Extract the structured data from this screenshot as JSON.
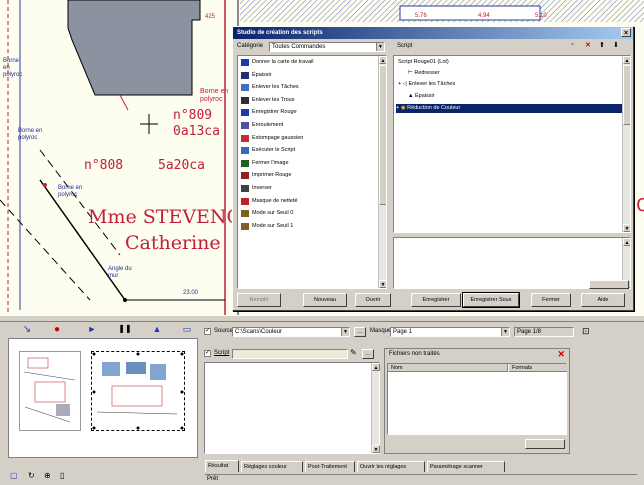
{
  "map": {
    "number_top_1": "425",
    "number_top_2": "5.76",
    "number_top_3": "4.94",
    "number_top_4": "5.10",
    "parcel_809_number": "n°809",
    "parcel_809_area": "0a13ca",
    "parcel_808_number": "n°808",
    "parcel_808_area": "5a20ca",
    "owner_line1": "Mme STEVENC",
    "owner_line2": "Catherine",
    "borne_label_1": "Borne en polyroc",
    "borne_label_2": "Borne en polyroc",
    "borne_label_3": "Borne en polyroc",
    "angle_label": "Angle du mur",
    "dim_label": "23.00",
    "edge_letter": "C"
  },
  "dialog": {
    "title": "Studio de création des scripts",
    "category_label": "Catégorie",
    "category_value": "Toutes Commandes",
    "script_label": "Script",
    "commands": [
      {
        "label": "Donner la carte de travail",
        "icon": "map-icon"
      },
      {
        "label": "Épaissir",
        "icon": "thicken-icon"
      },
      {
        "label": "Enlever les Tâches",
        "icon": "spots-icon"
      },
      {
        "label": "Enlever les Trous",
        "icon": "holes-icon"
      },
      {
        "label": "Enregistrer Rouge",
        "icon": "save-red-icon"
      },
      {
        "label": "Enroulement",
        "icon": "wrap-icon"
      },
      {
        "label": "Estompage gaussien",
        "icon": "gauss-icon"
      },
      {
        "label": "Exécuter le Script",
        "icon": "run-icon"
      },
      {
        "label": "Fermer l'image",
        "icon": "close-image-icon"
      },
      {
        "label": "Imprimer Rouge",
        "icon": "print-icon"
      },
      {
        "label": "Inverser",
        "icon": "invert-icon"
      },
      {
        "label": "Masque de netteté",
        "icon": "sharpen-icon"
      },
      {
        "label": "Mode sur Seuil 0",
        "icon": "threshold-icon"
      },
      {
        "label": "Mode sur Seuil 1",
        "icon": "threshold-icon"
      }
    ],
    "tree_root": "Script Rouge01 (Lot)",
    "tree_items": [
      "Redresser",
      "Enlever les Tâches",
      "Épaissir",
      "Réduction de Couleur"
    ],
    "buttons": {
      "help": "Remplir",
      "new": "Nouveau",
      "open": "Ouvrir",
      "save": "Enregistrer",
      "save_as": "Enregistrer Sous",
      "close": "Fermer",
      "aide": "Aide"
    }
  },
  "lower": {
    "source_label": "Source",
    "source_value": "C:\\Scans\\Couleur",
    "mask_label": "Masque",
    "mask_value": "Page 1",
    "page_label": "Page 1/8",
    "script_label": "Script",
    "files_panel_title": "Fichiers non traités",
    "col_name": "Nom",
    "col_format": "Formats",
    "tabs": [
      "Résultat",
      "Réglages couleur",
      "Post-Traitement",
      "Ouvrir les réglages",
      "Paramétrage scanner"
    ],
    "status": "Prêt"
  },
  "colors": {
    "titlebar": "#0a246a",
    "selection": "#0a246a",
    "map_red": "#c0203a",
    "map_blue": "#1f2f9c"
  }
}
